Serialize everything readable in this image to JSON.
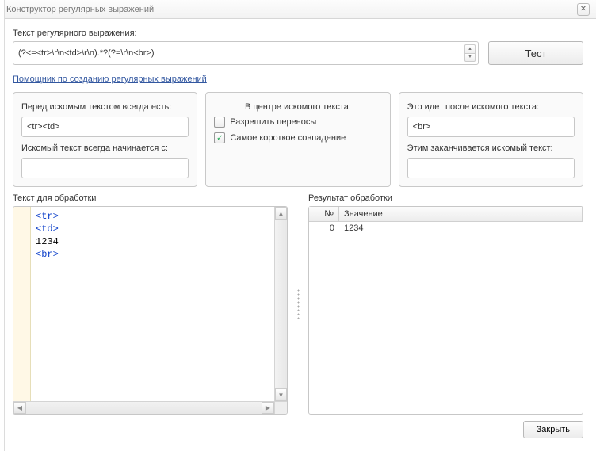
{
  "window": {
    "title": "Конструктор регулярных выражений"
  },
  "regex": {
    "label": "Текст регулярного выражения:",
    "value": "(?<=<tr>\\r\\n<td>\\r\\n).*?(?=\\r\\n<br>)"
  },
  "buttons": {
    "test": "Тест",
    "close": "Закрыть"
  },
  "help_link": "Помощник по созданию регулярных выражений",
  "groups": {
    "before": {
      "label1": "Перед искомым текстом всегда есть:",
      "value1": "<tr><td>",
      "label2": "Искомый текст всегда начинается с:",
      "value2": ""
    },
    "center": {
      "title": "В центре искомого текста:",
      "allow_wrap_label": "Разрешить переносы",
      "allow_wrap_checked": false,
      "shortest_label": "Самое короткое совпадение",
      "shortest_checked": true
    },
    "after": {
      "label1": "Это идет после искомого текста:",
      "value1": "<br>",
      "label2": "Этим заканчивается искомый текст:",
      "value2": ""
    }
  },
  "source": {
    "title": "Текст для обработки",
    "lines": [
      {
        "type": "tag",
        "text": "<tr>"
      },
      {
        "type": "tag",
        "text": "<td>"
      },
      {
        "type": "plain",
        "text": "1234"
      },
      {
        "type": "tag",
        "text": "<br>"
      }
    ]
  },
  "results": {
    "title": "Результат обработки",
    "columns": {
      "num": "№",
      "val": "Значение"
    },
    "rows": [
      {
        "num": "0",
        "val": "1234"
      }
    ]
  }
}
